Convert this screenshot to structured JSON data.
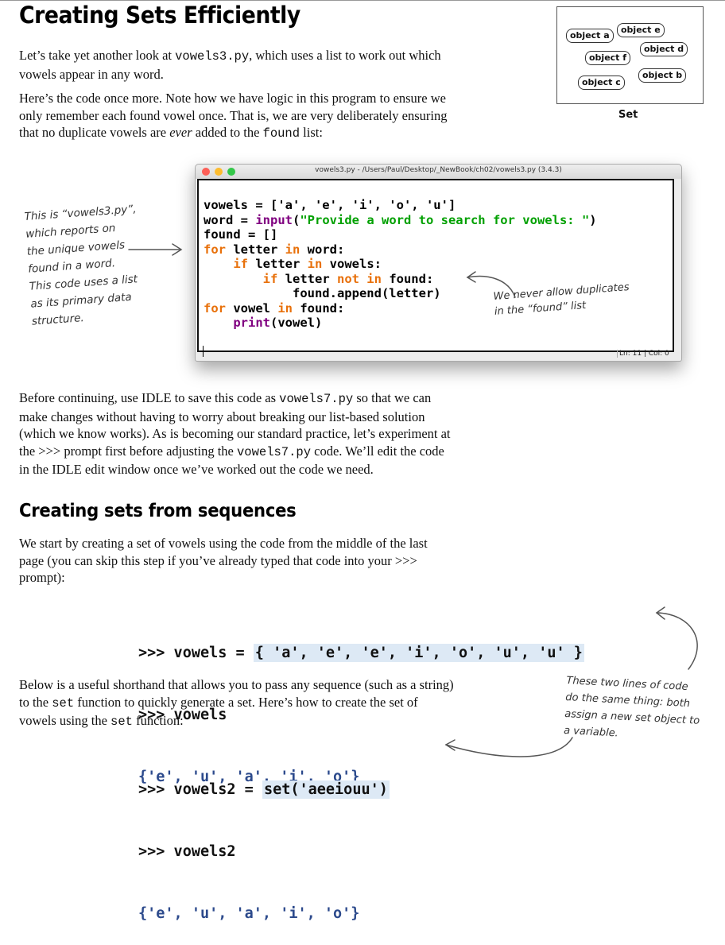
{
  "heading1": "Creating Sets Efficiently",
  "intro": {
    "p1_before": "Let’s take yet another look at ",
    "p1_code": "vowels3.py",
    "p1_after": ", which uses a list to work out which",
    "p1_line2": "vowels appear in any word.",
    "p2_l1": "Here’s the code once more. Note how we have logic in this program to ensure we",
    "p2_l2": "only remember each found vowel once. That is, we are very deliberately ensuring",
    "p2_l3_before": "that no duplicate vowels are ",
    "p2_l3_em": "ever",
    "p2_l3_mid": " added to the ",
    "p2_l3_code": "found",
    "p2_l3_after": " list:"
  },
  "set_diagram": {
    "objects": [
      "object a",
      "object e",
      "object d",
      "object f",
      "object b",
      "object c"
    ],
    "label": "Set"
  },
  "idle_window": {
    "title": "vowels3.py - /Users/Paul/Desktop/_NewBook/ch02/vowels3.py (3.4.3)",
    "status_ln": "Ln: 11",
    "status_col": "Col: 0",
    "traffic_colors": [
      "#fc5f57",
      "#fdbc2e",
      "#33c748"
    ],
    "code": {
      "l1": "vowels = ['a', 'e', 'i', 'o', 'u']",
      "l2_a": "word = ",
      "l2_b": "input",
      "l2_c": "(",
      "l2_d": "\"Provide a word to search for vowels: \"",
      "l2_e": ")",
      "l3": "found = []",
      "l4_kw": "for",
      "l4_a": " letter ",
      "l4_kw2": "in",
      "l4_b": " word:",
      "l5_kw": "if",
      "l5_a": " letter ",
      "l5_kw2": "in",
      "l5_b": " vowels:",
      "l6_kw": "if",
      "l6_a": " letter ",
      "l6_kw2": "not in",
      "l6_b": " found:",
      "l7": "found.append(letter)",
      "l8_kw": "for",
      "l8_a": " vowel ",
      "l8_kw2": "in",
      "l8_b": " found:",
      "l9_bi": "print",
      "l9_a": "(vowel)"
    }
  },
  "note_left": [
    "This is “vowels3.py”,",
    "which reports on",
    "the unique vowels",
    "found in a word.",
    "This code uses a list",
    "as its primary data",
    "structure."
  ],
  "note_right": [
    "We never allow duplicates",
    "in the “found” list"
  ],
  "para3": {
    "l1_before": "Before continuing, use IDLE to save this code as ",
    "l1_code": "vowels7.py",
    "l1_after": " so that we can",
    "l2": "make changes without having to worry about breaking our list-based solution",
    "l3": "(which we know works).  As is becoming our standard practice, let’s experiment at",
    "l4_before": "the >>> prompt first before adjusting the ",
    "l4_code": "vowels7.py",
    "l4_after": " code. We’ll edit the code",
    "l5": "in the IDLE edit window once we’ve worked out the code we need."
  },
  "heading2": "Creating sets from sequences",
  "para4": {
    "l1": "We start by creating a set of vowels using the code from the middle of the last",
    "l2": "page (you can skip this step if you’ve already typed that code into your >>>",
    "l3": "prompt):"
  },
  "repl1": {
    "l1_prompt": ">>> vowels = ",
    "l1_hl": "{ 'a', 'e', 'e', 'i', 'o', 'u', 'u' }",
    "l2": ">>> vowels",
    "l3": "{'e', 'u', 'a', 'i', 'o'}"
  },
  "para5": {
    "l1": "Below is a useful shorthand that allows you to pass any sequence (such as a string)",
    "l2_before": "to the ",
    "l2_code": "set",
    "l2_after": " function to quickly generate a set. Here’s how to create the set of",
    "l3_before": "vowels using the ",
    "l3_code": "set",
    "l3_after": " function:"
  },
  "repl2": {
    "l1_prompt": ">>> vowels2 = ",
    "l1_hl": "set('aeeiouu')",
    "l2": ">>> vowels2",
    "l3": "{'e', 'u', 'a', 'i', 'o'}"
  },
  "note_bottom": [
    "These two lines of code",
    "do the same thing: both",
    "assign a new set object to",
    "a variable."
  ]
}
